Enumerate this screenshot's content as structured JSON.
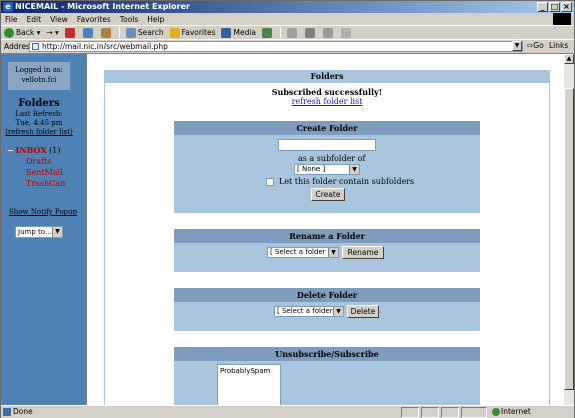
{
  "window": {
    "title": "NICEMAIL - Microsoft Internet Explorer"
  },
  "menu": [
    "File",
    "Edit",
    "View",
    "Favorites",
    "Tools",
    "Help"
  ],
  "toolbar": {
    "back": "Back",
    "search": "Search",
    "favorites": "Favorites",
    "media": "Media"
  },
  "address": {
    "label": "Address",
    "url": "http://mail.nic.in/src/webmail.php",
    "go": "Go",
    "links": "Links"
  },
  "left": {
    "logged_in_label": "Logged in as:",
    "user": "vellotn.fci",
    "folders_title": "Folders",
    "last_refresh_label": "Last Refresh:",
    "last_refresh_time": "Tue, 4:45 pm",
    "refresh_link": "(refresh folder list)",
    "inbox_label": "INBOX",
    "inbox_count": "(1)",
    "subfolders": [
      "Drafts",
      "SentMail",
      "TrashCan"
    ],
    "notify_popup": "Show Notify Popup",
    "jump_to": "Jump to..."
  },
  "main": {
    "header": "Folders",
    "success": "Subscribed successfully!",
    "refresh_link": "refresh folder list",
    "create": {
      "title": "Create Folder",
      "name_value": "",
      "subfolder_of": "as a subfolder of",
      "parent_selected": "[ None ]",
      "contain_subfolders": "Let this folder contain subfolders",
      "contain_checked": false,
      "button": "Create"
    },
    "rename": {
      "title": "Rename a Folder",
      "select": "[ Select a folder ]",
      "button": "Rename"
    },
    "delete": {
      "title": "Delete Folder",
      "select": "[ Select a folder ]",
      "button": "Delete"
    },
    "unsubscribe": {
      "title": "Unsubscribe/Subscribe",
      "folders": [
        "ProbablySpam"
      ]
    }
  },
  "status": {
    "text": "Done",
    "zone": "Internet"
  }
}
